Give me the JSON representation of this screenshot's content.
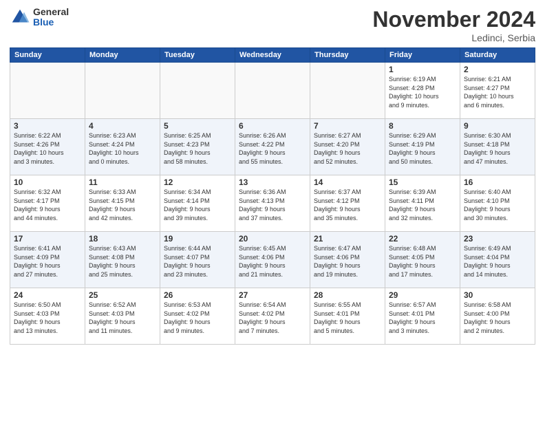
{
  "header": {
    "logo_general": "General",
    "logo_blue": "Blue",
    "month_title": "November 2024",
    "location": "Ledinci, Serbia"
  },
  "weekdays": [
    "Sunday",
    "Monday",
    "Tuesday",
    "Wednesday",
    "Thursday",
    "Friday",
    "Saturday"
  ],
  "rows": [
    [
      {
        "day": "",
        "info": "",
        "empty": true
      },
      {
        "day": "",
        "info": "",
        "empty": true
      },
      {
        "day": "",
        "info": "",
        "empty": true
      },
      {
        "day": "",
        "info": "",
        "empty": true
      },
      {
        "day": "",
        "info": "",
        "empty": true
      },
      {
        "day": "1",
        "info": "Sunrise: 6:19 AM\nSunset: 4:28 PM\nDaylight: 10 hours\nand 9 minutes."
      },
      {
        "day": "2",
        "info": "Sunrise: 6:21 AM\nSunset: 4:27 PM\nDaylight: 10 hours\nand 6 minutes."
      }
    ],
    [
      {
        "day": "3",
        "info": "Sunrise: 6:22 AM\nSunset: 4:26 PM\nDaylight: 10 hours\nand 3 minutes."
      },
      {
        "day": "4",
        "info": "Sunrise: 6:23 AM\nSunset: 4:24 PM\nDaylight: 10 hours\nand 0 minutes."
      },
      {
        "day": "5",
        "info": "Sunrise: 6:25 AM\nSunset: 4:23 PM\nDaylight: 9 hours\nand 58 minutes."
      },
      {
        "day": "6",
        "info": "Sunrise: 6:26 AM\nSunset: 4:22 PM\nDaylight: 9 hours\nand 55 minutes."
      },
      {
        "day": "7",
        "info": "Sunrise: 6:27 AM\nSunset: 4:20 PM\nDaylight: 9 hours\nand 52 minutes."
      },
      {
        "day": "8",
        "info": "Sunrise: 6:29 AM\nSunset: 4:19 PM\nDaylight: 9 hours\nand 50 minutes."
      },
      {
        "day": "9",
        "info": "Sunrise: 6:30 AM\nSunset: 4:18 PM\nDaylight: 9 hours\nand 47 minutes."
      }
    ],
    [
      {
        "day": "10",
        "info": "Sunrise: 6:32 AM\nSunset: 4:17 PM\nDaylight: 9 hours\nand 44 minutes."
      },
      {
        "day": "11",
        "info": "Sunrise: 6:33 AM\nSunset: 4:15 PM\nDaylight: 9 hours\nand 42 minutes."
      },
      {
        "day": "12",
        "info": "Sunrise: 6:34 AM\nSunset: 4:14 PM\nDaylight: 9 hours\nand 39 minutes."
      },
      {
        "day": "13",
        "info": "Sunrise: 6:36 AM\nSunset: 4:13 PM\nDaylight: 9 hours\nand 37 minutes."
      },
      {
        "day": "14",
        "info": "Sunrise: 6:37 AM\nSunset: 4:12 PM\nDaylight: 9 hours\nand 35 minutes."
      },
      {
        "day": "15",
        "info": "Sunrise: 6:39 AM\nSunset: 4:11 PM\nDaylight: 9 hours\nand 32 minutes."
      },
      {
        "day": "16",
        "info": "Sunrise: 6:40 AM\nSunset: 4:10 PM\nDaylight: 9 hours\nand 30 minutes."
      }
    ],
    [
      {
        "day": "17",
        "info": "Sunrise: 6:41 AM\nSunset: 4:09 PM\nDaylight: 9 hours\nand 27 minutes."
      },
      {
        "day": "18",
        "info": "Sunrise: 6:43 AM\nSunset: 4:08 PM\nDaylight: 9 hours\nand 25 minutes."
      },
      {
        "day": "19",
        "info": "Sunrise: 6:44 AM\nSunset: 4:07 PM\nDaylight: 9 hours\nand 23 minutes."
      },
      {
        "day": "20",
        "info": "Sunrise: 6:45 AM\nSunset: 4:06 PM\nDaylight: 9 hours\nand 21 minutes."
      },
      {
        "day": "21",
        "info": "Sunrise: 6:47 AM\nSunset: 4:06 PM\nDaylight: 9 hours\nand 19 minutes."
      },
      {
        "day": "22",
        "info": "Sunrise: 6:48 AM\nSunset: 4:05 PM\nDaylight: 9 hours\nand 17 minutes."
      },
      {
        "day": "23",
        "info": "Sunrise: 6:49 AM\nSunset: 4:04 PM\nDaylight: 9 hours\nand 14 minutes."
      }
    ],
    [
      {
        "day": "24",
        "info": "Sunrise: 6:50 AM\nSunset: 4:03 PM\nDaylight: 9 hours\nand 13 minutes."
      },
      {
        "day": "25",
        "info": "Sunrise: 6:52 AM\nSunset: 4:03 PM\nDaylight: 9 hours\nand 11 minutes."
      },
      {
        "day": "26",
        "info": "Sunrise: 6:53 AM\nSunset: 4:02 PM\nDaylight: 9 hours\nand 9 minutes."
      },
      {
        "day": "27",
        "info": "Sunrise: 6:54 AM\nSunset: 4:02 PM\nDaylight: 9 hours\nand 7 minutes."
      },
      {
        "day": "28",
        "info": "Sunrise: 6:55 AM\nSunset: 4:01 PM\nDaylight: 9 hours\nand 5 minutes."
      },
      {
        "day": "29",
        "info": "Sunrise: 6:57 AM\nSunset: 4:01 PM\nDaylight: 9 hours\nand 3 minutes."
      },
      {
        "day": "30",
        "info": "Sunrise: 6:58 AM\nSunset: 4:00 PM\nDaylight: 9 hours\nand 2 minutes."
      }
    ]
  ]
}
